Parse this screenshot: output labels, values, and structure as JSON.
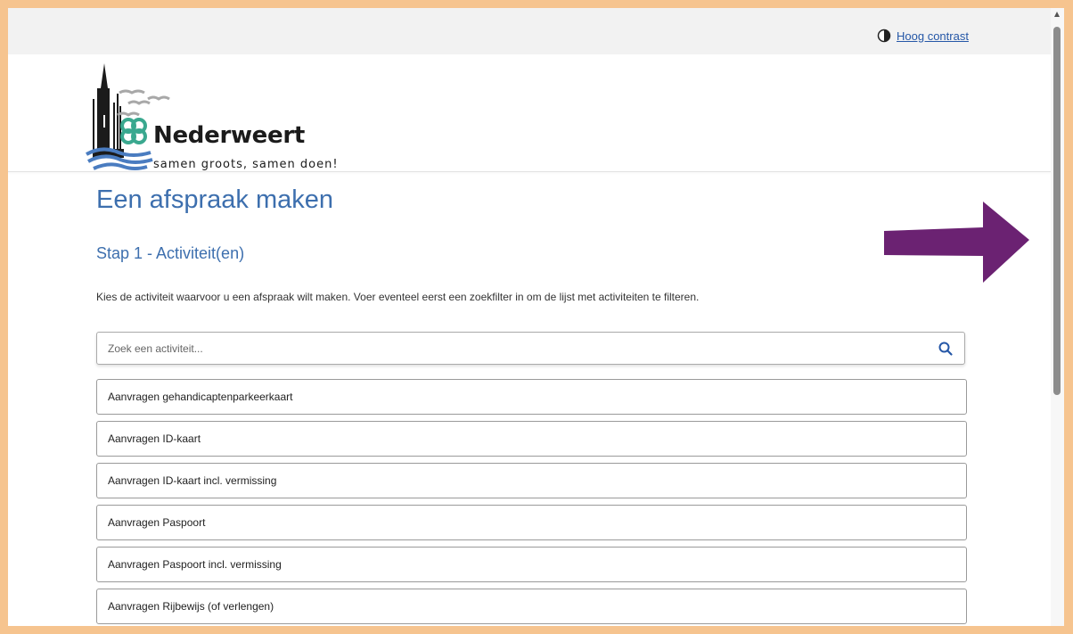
{
  "topbar": {
    "contrast_label": "Hoog contrast",
    "contrast_icon": "contrast-half-circle-icon"
  },
  "header": {
    "logo_name": "Nederweert",
    "logo_tagline": "samen groots, samen doen!"
  },
  "main": {
    "title": "Een afspraak maken",
    "step_title": "Stap 1 - Activiteit(en)",
    "instructions": "Kies de activiteit waarvoor u een afspraak wilt maken. Voer eventeel eerst een zoekfilter in om de lijst met activiteiten te filteren.",
    "search": {
      "placeholder": "Zoek een activiteit...",
      "value": ""
    },
    "activities": [
      "Aanvragen gehandicaptenparkeerkaart",
      "Aanvragen ID-kaart",
      "Aanvragen ID-kaart incl. vermissing",
      "Aanvragen Paspoort",
      "Aanvragen Paspoort incl. vermissing",
      "Aanvragen Rijbewijs (of verlengen)"
    ]
  },
  "colors": {
    "page_border": "#f6c48f",
    "heading": "#3d6fae",
    "link": "#2557a7",
    "annotation_arrow": "#6b2272",
    "logo_blue": "#4a7cc0",
    "logo_green": "#3aa88f"
  }
}
